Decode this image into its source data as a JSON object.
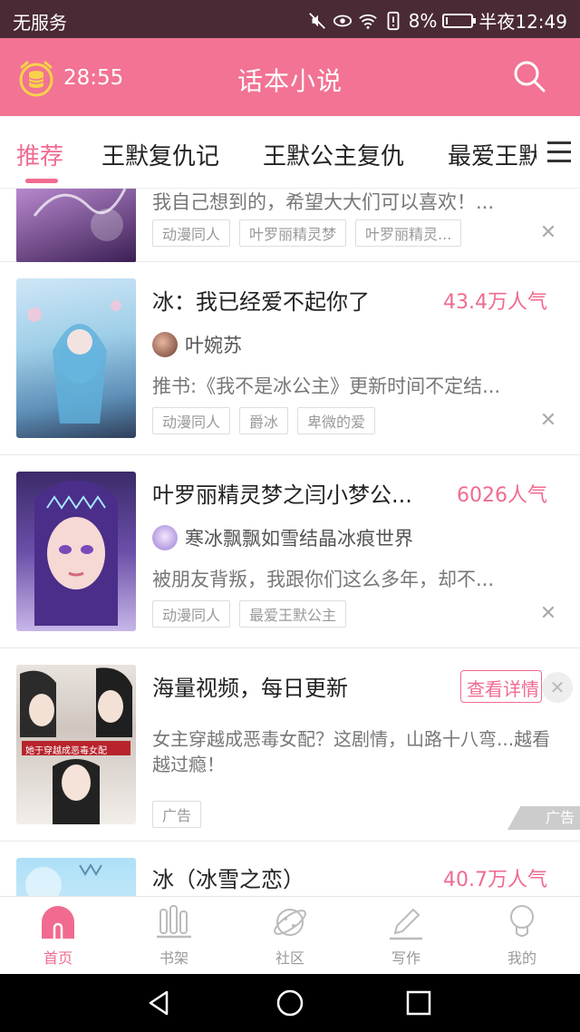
{
  "status_bar": {
    "carrier": "无服务",
    "battery": "8%",
    "time": "半夜12:49",
    "battery_level": 0.08
  },
  "header": {
    "timer": "28:55",
    "title": "话本小说"
  },
  "tabs": [
    {
      "label": "推荐",
      "active": true
    },
    {
      "label": "王默复仇记"
    },
    {
      "label": "王默公主复仇"
    },
    {
      "label": "最爱王默公主"
    }
  ],
  "items": [
    {
      "desc": "我自己想到的，希望大大们可以喜欢！...",
      "tags": [
        "动漫同人",
        "叶罗丽精灵梦",
        "叶罗丽精灵..."
      ]
    },
    {
      "title": "冰：我已经爱不起你了",
      "popularity": "43.4万人气",
      "author": "叶婉苏",
      "desc": "推书:《我不是冰公主》更新时间不定结...",
      "tags": [
        "动漫同人",
        "爵冰",
        "卑微的爱"
      ]
    },
    {
      "title": "叶罗丽精灵梦之闫小梦公...",
      "popularity": "6026人气",
      "author": "寒冰飘飘如雪结晶冰痕世界",
      "desc": "被朋友背叛，我跟你们这么多年，却不...",
      "tags": [
        "动漫同人",
        "最爱王默公主"
      ]
    },
    {
      "title": "冰（冰雪之恋）",
      "popularity": "40.7万人气"
    }
  ],
  "ad": {
    "title": "海量视频，每日更新",
    "button": "查看详情",
    "desc": "女主穿越成恶毒女配？这剧情，山路十八弯...越看越过瘾！",
    "tag": "广告",
    "badge": "广告",
    "cover_caption": "她于穿越成恶毒女配"
  },
  "bottom_nav": [
    {
      "label": "首页",
      "icon": "home-icon",
      "active": true
    },
    {
      "label": "书架",
      "icon": "bookshelf-icon"
    },
    {
      "label": "社区",
      "icon": "planet-icon"
    },
    {
      "label": "写作",
      "icon": "pen-icon"
    },
    {
      "label": "我的",
      "icon": "profile-icon"
    }
  ],
  "colors": {
    "accent": "#f06b8f",
    "header": "#f27393",
    "status_bar": "#4a2a34"
  }
}
